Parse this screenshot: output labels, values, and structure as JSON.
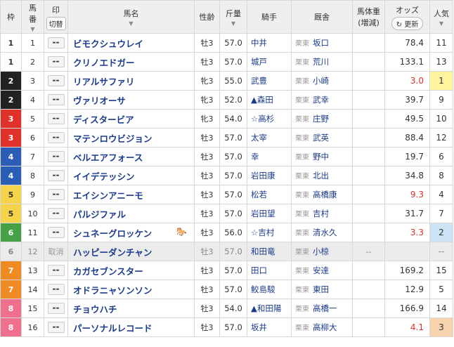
{
  "headers": {
    "waku": "枠",
    "umaban_1": "馬",
    "umaban_2": "番",
    "mark": "印",
    "mark_button": "切替",
    "horse": "馬名",
    "sexage": "性齢",
    "weight": "斤量",
    "jockey": "騎手",
    "trainer": "厩舎",
    "bodyw_1": "馬体重",
    "bodyw_2": "(増減)",
    "odds": "オッズ",
    "odds_button": "更新",
    "pop_1": "人気",
    "sort_icon": "▼"
  },
  "mark_placeholder": "--",
  "rows": [
    {
      "waku": "1",
      "umaban": "1",
      "mark": "--",
      "horse": "ビモクシュウレイ",
      "sexage": "牡3",
      "weight": "57.0",
      "jockey": "中井",
      "region": "栗東",
      "trainer": "坂口",
      "bodyw": "",
      "odds": "78.4",
      "pop": "11"
    },
    {
      "waku": "1",
      "umaban": "2",
      "mark": "--",
      "horse": "クリノエドガー",
      "sexage": "牡3",
      "weight": "57.0",
      "jockey": "城戸",
      "region": "栗東",
      "trainer": "荒川",
      "bodyw": "",
      "odds": "133.1",
      "pop": "13"
    },
    {
      "waku": "2",
      "umaban": "3",
      "mark": "--",
      "horse": "リアルサファリ",
      "sexage": "牝3",
      "weight": "55.0",
      "jockey": "武豊",
      "region": "栗東",
      "trainer": "小崎",
      "bodyw": "",
      "odds": "3.0",
      "pop": "1"
    },
    {
      "waku": "2",
      "umaban": "4",
      "mark": "--",
      "horse": "ヴァリオーサ",
      "sexage": "牝3",
      "weight": "52.0",
      "jockey": "▲森田",
      "region": "栗東",
      "trainer": "武幸",
      "bodyw": "",
      "odds": "39.7",
      "pop": "9"
    },
    {
      "waku": "3",
      "umaban": "5",
      "mark": "--",
      "horse": "ディスタービア",
      "sexage": "牝3",
      "weight": "54.0",
      "jockey": "☆高杉",
      "region": "栗東",
      "trainer": "庄野",
      "bodyw": "",
      "odds": "49.5",
      "pop": "10"
    },
    {
      "waku": "3",
      "umaban": "6",
      "mark": "--",
      "horse": "マテンロウビジョン",
      "sexage": "牡3",
      "weight": "57.0",
      "jockey": "太宰",
      "region": "栗東",
      "trainer": "武英",
      "bodyw": "",
      "odds": "88.4",
      "pop": "12"
    },
    {
      "waku": "4",
      "umaban": "7",
      "mark": "--",
      "horse": "ベルエアフォース",
      "sexage": "牡3",
      "weight": "57.0",
      "jockey": "幸",
      "region": "栗東",
      "trainer": "野中",
      "bodyw": "",
      "odds": "19.7",
      "pop": "6"
    },
    {
      "waku": "4",
      "umaban": "8",
      "mark": "--",
      "horse": "イイデテッシン",
      "sexage": "牡3",
      "weight": "57.0",
      "jockey": "岩田康",
      "region": "栗東",
      "trainer": "北出",
      "bodyw": "",
      "odds": "34.8",
      "pop": "8"
    },
    {
      "waku": "5",
      "umaban": "9",
      "mark": "--",
      "horse": "エイシンアニーモ",
      "sexage": "牡3",
      "weight": "57.0",
      "jockey": "松若",
      "region": "栗東",
      "trainer": "高橋康",
      "bodyw": "",
      "odds": "9.3",
      "pop": "4"
    },
    {
      "waku": "5",
      "umaban": "10",
      "mark": "--",
      "horse": "パルジファル",
      "sexage": "牡3",
      "weight": "57.0",
      "jockey": "岩田望",
      "region": "栗東",
      "trainer": "吉村",
      "bodyw": "",
      "odds": "31.7",
      "pop": "7"
    },
    {
      "waku": "6",
      "umaban": "11",
      "mark": "--",
      "horse": "シュネーグロッケン",
      "sexage": "牡3",
      "weight": "56.0",
      "jockey": "☆吉村",
      "region": "栗東",
      "trainer": "清水久",
      "bodyw": "",
      "odds": "3.3",
      "pop": "2"
    },
    {
      "waku": "6",
      "umaban": "12",
      "mark": "取消",
      "horse": "ハッピーダンチャン",
      "sexage": "牡3",
      "weight": "57.0",
      "jockey": "和田竜",
      "region": "栗東",
      "trainer": "小椋",
      "bodyw": "--",
      "odds": "",
      "pop": "--",
      "cancelled": true
    },
    {
      "waku": "7",
      "umaban": "13",
      "mark": "--",
      "horse": "カガセブンスター",
      "sexage": "牡3",
      "weight": "57.0",
      "jockey": "田口",
      "region": "栗東",
      "trainer": "安達",
      "bodyw": "",
      "odds": "169.2",
      "pop": "15"
    },
    {
      "waku": "7",
      "umaban": "14",
      "mark": "--",
      "horse": "オドラニャソンソン",
      "sexage": "牡3",
      "weight": "57.0",
      "jockey": "鮫島駿",
      "region": "栗東",
      "trainer": "東田",
      "bodyw": "",
      "odds": "12.9",
      "pop": "5"
    },
    {
      "waku": "8",
      "umaban": "15",
      "mark": "--",
      "horse": "チョウハチ",
      "sexage": "牡3",
      "weight": "54.0",
      "jockey": "▲和田陽",
      "region": "栗東",
      "trainer": "高橋一",
      "bodyw": "",
      "odds": "166.9",
      "pop": "14"
    },
    {
      "waku": "8",
      "umaban": "16",
      "mark": "--",
      "horse": "パーソナルレコード",
      "sexage": "牡3",
      "weight": "57.0",
      "jockey": "坂井",
      "region": "栗東",
      "trainer": "高柳大",
      "bodyw": "",
      "odds": "4.1",
      "pop": "3"
    }
  ]
}
